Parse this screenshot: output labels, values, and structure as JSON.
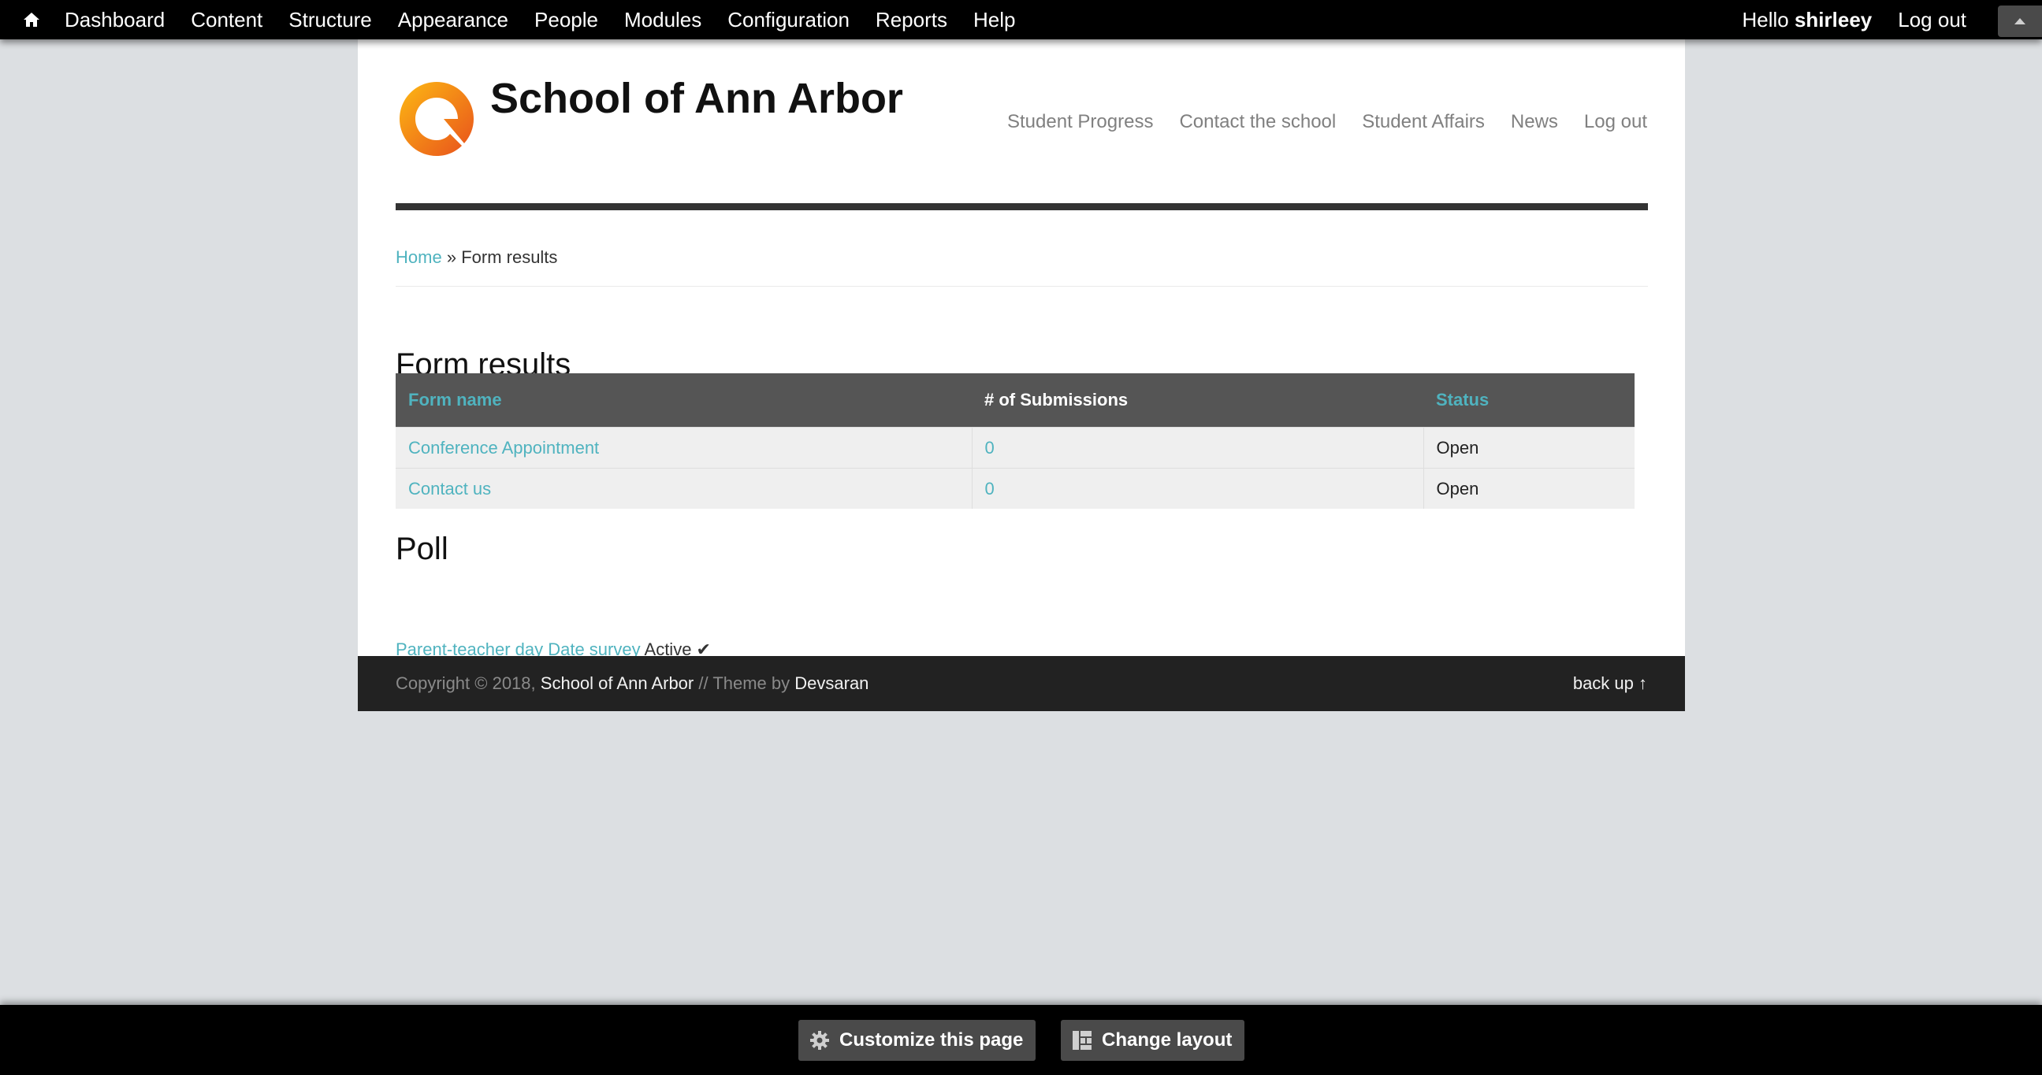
{
  "toolbar": {
    "menu": [
      {
        "label": "Dashboard"
      },
      {
        "label": "Content"
      },
      {
        "label": "Structure"
      },
      {
        "label": "Appearance"
      },
      {
        "label": "People"
      },
      {
        "label": "Modules"
      },
      {
        "label": "Configuration"
      },
      {
        "label": "Reports"
      },
      {
        "label": "Help"
      }
    ],
    "greeting_prefix": "Hello",
    "username": "shirleey",
    "logout_label": "Log out"
  },
  "site": {
    "name": "School of Ann Arbor",
    "logo_colors": {
      "outer": "#f08a1c",
      "inner": "#fdb913"
    },
    "nav": [
      {
        "label": "Student Progress"
      },
      {
        "label": "Contact the school"
      },
      {
        "label": "Student Affairs"
      },
      {
        "label": "News"
      },
      {
        "label": "Log out"
      }
    ]
  },
  "breadcrumb": {
    "home_label": "Home",
    "separator": "»",
    "current": "Form results"
  },
  "page_title": "Form results",
  "results_table": {
    "headers": {
      "form_name": "Form name",
      "submissions": "# of Submissions",
      "status": "Status"
    },
    "rows": [
      {
        "form_name": "Conference Appointment",
        "submissions": "0",
        "status": "Open"
      },
      {
        "form_name": "Contact us",
        "submissions": "0",
        "status": "Open"
      }
    ]
  },
  "poll": {
    "title": "Poll",
    "survey_label": "Parent-teacher day Date survey",
    "status": "Active ✔"
  },
  "footer": {
    "copyright_prefix": "Copyright © 2018,",
    "site_link": "School of Ann Arbor",
    "theme_text": "// Theme by",
    "theme_link": "Devsaran",
    "back_up": "back up ↑"
  },
  "bottom_bar": {
    "customize_label": "Customize this page",
    "layout_label": "Change layout"
  },
  "colors": {
    "accent_link": "#4fb3bf",
    "toolbar_bg": "#000000",
    "table_header_bg": "#555555",
    "footer_bg": "#222222"
  }
}
